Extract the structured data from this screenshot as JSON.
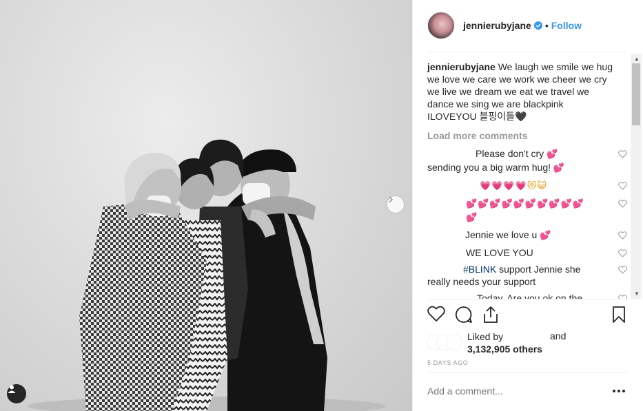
{
  "photo": {
    "alt_icons": {
      "next": "chevron-right-icon",
      "tag": "user-icon"
    },
    "slide_count": 2,
    "active_slide": 1
  },
  "post": {
    "username": "jennierubyjane",
    "verified": true,
    "separator": "•",
    "follow_label": "Follow",
    "caption_user": "jennierubyjane",
    "caption_text": "We laugh we smile we hug we love we care we work we cheer we cry we live we dream we eat we travel we dance we sing we are blackpink ILOVEYOU 블핑이들",
    "caption_emoji": "🖤",
    "load_more": "Load more comments",
    "comments": [
      {
        "text": "Please don't cry",
        "emoji": "💕",
        "text2": "sending you a big warm hug!",
        "emoji2": "💕"
      },
      {
        "emoji": "💗💗💗💗",
        "emoji_cat": "😻😺"
      },
      {
        "emoji": "💕💕💕💕💕💕💕💕💕💕💕"
      },
      {
        "text": "Jennie we love u",
        "emoji": "💕"
      },
      {
        "text": "WE LOVE YOU"
      },
      {
        "hashtag": "#BLINK",
        "text": "support Jennie she really needs your support"
      },
      {
        "text": "Today. Are you ok on the"
      }
    ],
    "liked_by_label": "Liked by",
    "and_label": "and",
    "likes_count": "3,132,905 others",
    "timestamp": "5 DAYS AGO",
    "comment_placeholder": "Add a comment...",
    "colors": {
      "accent": "#3897f0",
      "text": "#262626",
      "muted": "#999999",
      "heart": "#d92b3a"
    }
  }
}
